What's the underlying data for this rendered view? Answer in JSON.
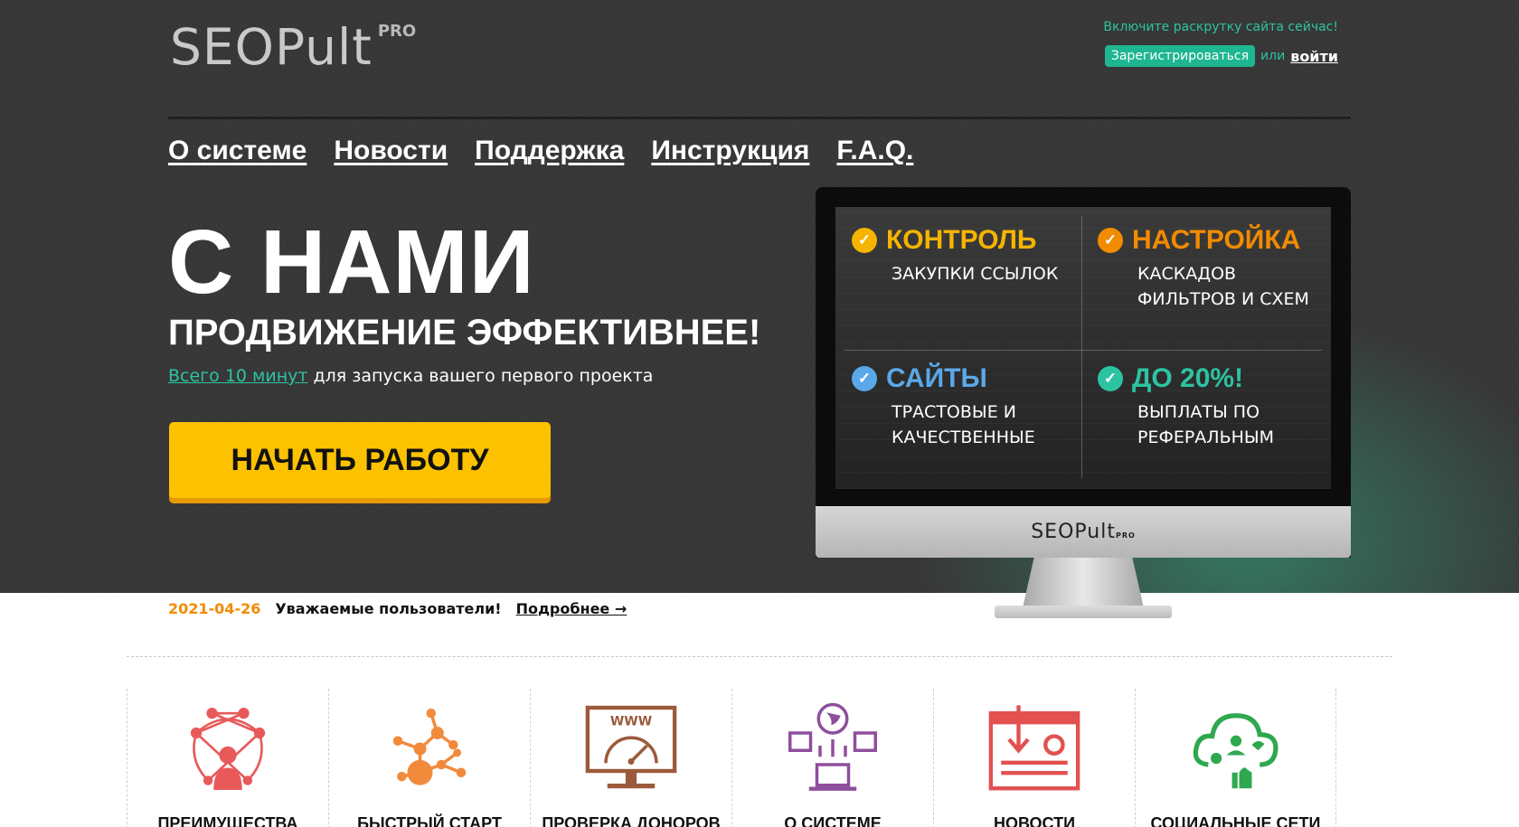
{
  "header": {
    "logo_text": "SEOPult",
    "logo_pro": "PRO",
    "promo": "Включите раскрутку сайта сейчас!",
    "register_label": "Зарегистрироваться",
    "or_label": "или",
    "login_label": "войти"
  },
  "nav": {
    "items": [
      "О системе",
      "Новости",
      "Поддержка",
      "Инструкция",
      "F.A.Q."
    ]
  },
  "hero": {
    "headline": "С НАМИ",
    "subheadline": "ПРОДВИЖЕНИЕ ЭФФЕКТИВНЕЕ!",
    "tagline_link": "Всего 10 минут",
    "tagline_rest": " для запуска вашего первого проекта",
    "cta_label": "НАЧАТЬ РАБОТУ"
  },
  "monitor": {
    "chin_logo": "SEOPult",
    "chin_pro": "PRO",
    "features": [
      {
        "title": "КОНТРОЛЬ",
        "text": "ЗАКУПКИ ССЫЛОК",
        "color": "#f5b400"
      },
      {
        "title": "НАСТРОЙКА",
        "text": "КАСКАДОВ ФИЛЬТРОВ И СХЕМ",
        "color": "#f28b00"
      },
      {
        "title": "САЙТЫ",
        "text": "ТРАСТОВЫЕ И КАЧЕСТВЕННЫЕ",
        "color": "#5aa8e8"
      },
      {
        "title": "ДО 20%!",
        "text": "ВЫПЛАТЫ ПО РЕФЕРАЛЬНЫМ",
        "color": "#2cc3a1"
      }
    ]
  },
  "news": {
    "date": "2021-04-26",
    "text": "Уважаемые пользователи!",
    "more": "Подробнее →"
  },
  "tiles": [
    {
      "label": "ПРЕИМУЩЕСТВА",
      "icon": "network-user-icon",
      "color": "#e85a5a"
    },
    {
      "label": "БЫСТРЫЙ СТАРТ",
      "icon": "molecule-icon",
      "color": "#f28a3c"
    },
    {
      "label": "ПРОВЕРКА ДОНОРОВ",
      "icon": "www-speedometer-icon",
      "color": "#9c5a3c"
    },
    {
      "label": "О СИСТЕМЕ",
      "icon": "globe-network-icon",
      "color": "#8e4f9c"
    },
    {
      "label": "НОВОСТИ",
      "icon": "news-download-icon",
      "color": "#e25050"
    },
    {
      "label": "СОЦИАЛЬНЫЕ СЕТИ",
      "icon": "social-cloud-icon",
      "color": "#2fa84f"
    }
  ]
}
